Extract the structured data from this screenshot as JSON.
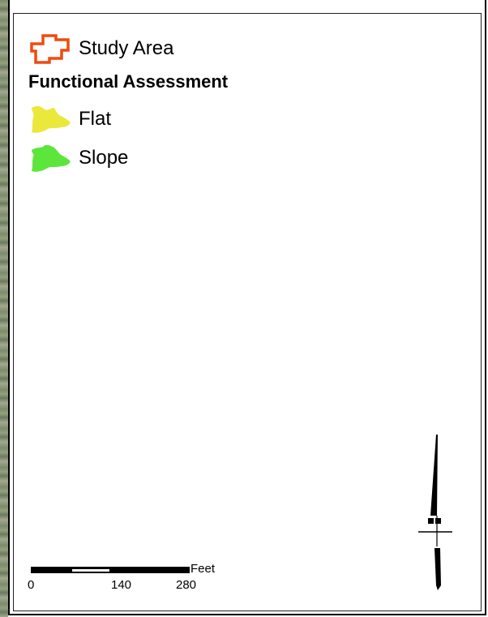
{
  "legend": {
    "study_area_label": "Study Area",
    "heading": "Functional Assessment",
    "items": [
      {
        "label": "Flat",
        "color": "#eae83a"
      },
      {
        "label": "Slope",
        "color": "#5ce63c"
      }
    ],
    "study_area_color": "#f04a10"
  },
  "scale_bar": {
    "unit": "Feet",
    "ticks": [
      "0",
      "140",
      "280"
    ]
  },
  "north_arrow": {
    "icon": "north-arrow-icon"
  }
}
